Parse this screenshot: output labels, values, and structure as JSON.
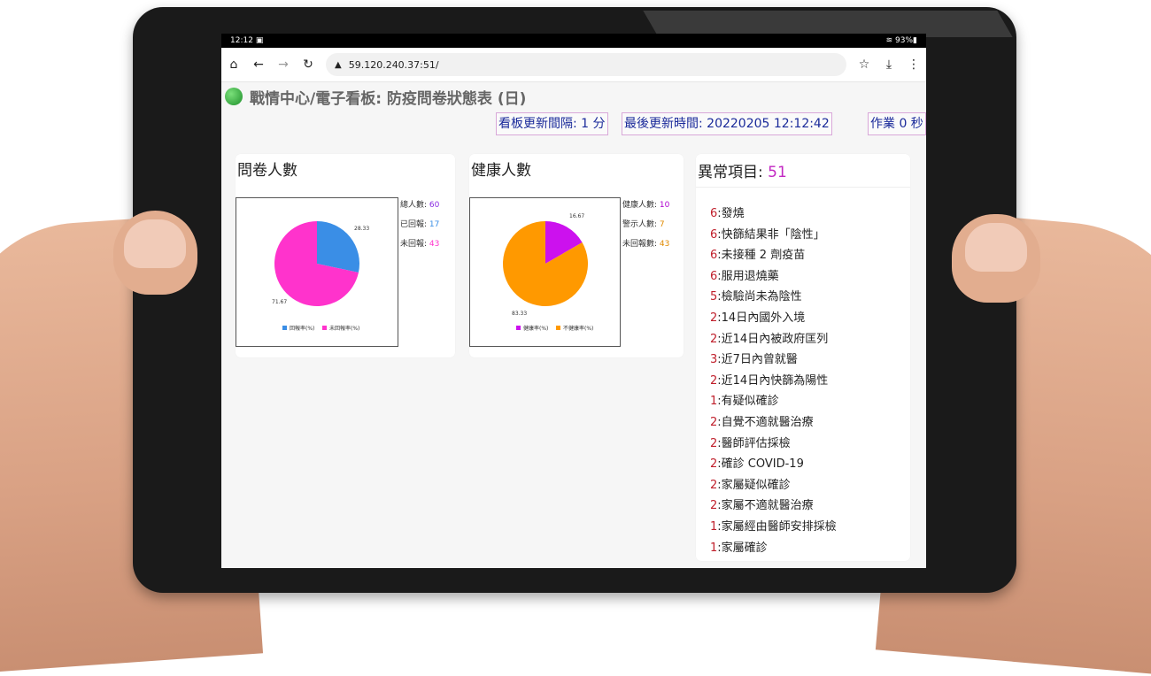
{
  "statusbar": {
    "time": "12:12",
    "battery": "93%"
  },
  "browser": {
    "url": "59.120.240.37:51/"
  },
  "page": {
    "title": "戰情中心/電子看板: 防疫問卷狀態表 (日)"
  },
  "info": {
    "update_interval": "看板更新間隔: 1 分",
    "last_update": "最後更新時間: 20220205 12:12:42",
    "job": "作業 0 秒"
  },
  "survey": {
    "title": "問卷人數",
    "stats": [
      {
        "label": "總人數: ",
        "value": "60",
        "color": "#8a2be2"
      },
      {
        "label": "已回報: ",
        "value": "17",
        "color": "#3a8ee6"
      },
      {
        "label": "未回報: ",
        "value": "43",
        "color": "#ff33cc"
      }
    ],
    "colors": {
      "reported": "#3a8ee6",
      "unreported": "#ff33cc"
    }
  },
  "health": {
    "title": "健康人數",
    "stats": [
      {
        "label": "健康人數: ",
        "value": "10",
        "color": "#b000d0"
      },
      {
        "label": "警示人數: ",
        "value": "7",
        "color": "#e08a00"
      },
      {
        "label": "未回報數: ",
        "value": "43",
        "color": "#e08a00"
      }
    ],
    "colors": {
      "healthy": "#cc11ee",
      "unhealthy": "#ff9900"
    }
  },
  "chart_data": [
    {
      "type": "pie",
      "categories": [
        "回報率(%)",
        "未回報率(%)"
      ],
      "values": [
        28.33,
        71.67
      ],
      "labels": [
        "28.33",
        "71.67"
      ],
      "colors": [
        "#3a8ee6",
        "#ff33cc"
      ],
      "legend": "bottom"
    },
    {
      "type": "pie",
      "categories": [
        "健康率(%)",
        "不健康率(%)"
      ],
      "values": [
        16.67,
        83.33
      ],
      "labels": [
        "16.67",
        "83.33"
      ],
      "colors": [
        "#cc11ee",
        "#ff9900"
      ],
      "legend": "bottom"
    }
  ],
  "anomalies": {
    "title": "異常項目: ",
    "count": "51",
    "items": [
      {
        "count": "6",
        "label": ":發燒"
      },
      {
        "count": "6",
        "label": ":快篩結果非「陰性」"
      },
      {
        "count": "6",
        "label": ":未接種 2 劑疫苗"
      },
      {
        "count": "6",
        "label": ":服用退燒藥"
      },
      {
        "count": "5",
        "label": ":檢驗尚未為陰性"
      },
      {
        "count": "2",
        "label": ":14日內國外入境"
      },
      {
        "count": "2",
        "label": ":近14日內被政府匡列"
      },
      {
        "count": "3",
        "label": ":近7日內曾就醫"
      },
      {
        "count": "2",
        "label": ":近14日內快篩為陽性"
      },
      {
        "count": "1",
        "label": ":有疑似確診"
      },
      {
        "count": "2",
        "label": ":自覺不適就醫治療"
      },
      {
        "count": "2",
        "label": ":醫師評估採檢"
      },
      {
        "count": "2",
        "label": ":確診 COVID-19"
      },
      {
        "count": "2",
        "label": ":家屬疑似確診"
      },
      {
        "count": "2",
        "label": ":家屬不適就醫治療"
      },
      {
        "count": "1",
        "label": ":家屬經由醫師安排採檢"
      },
      {
        "count": "1",
        "label": ":家屬確診"
      }
    ]
  }
}
